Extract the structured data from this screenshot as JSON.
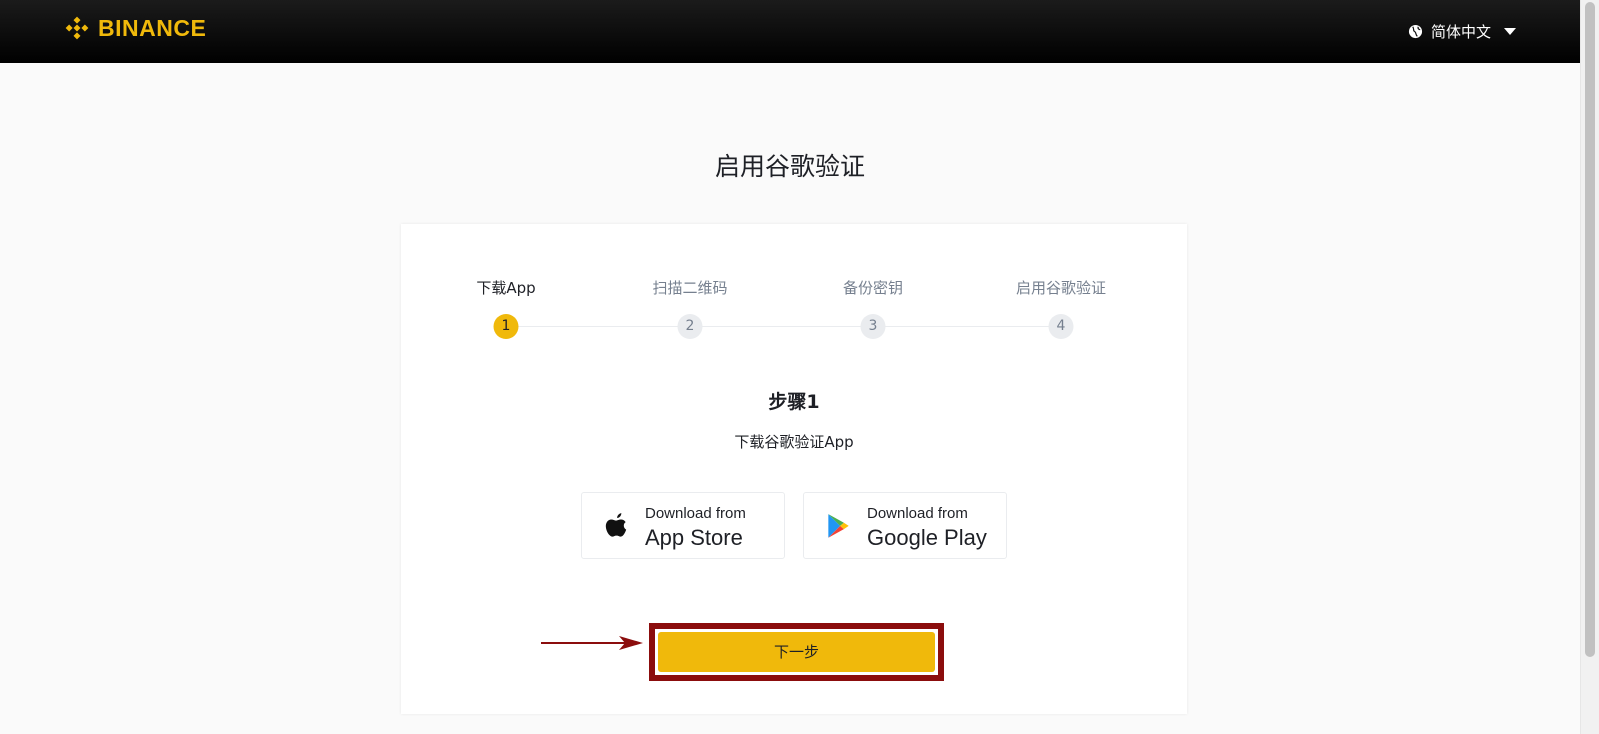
{
  "header": {
    "brand": "BINANCE",
    "language": "简体中文",
    "icons": {
      "logo": "binance-diamond-logo",
      "globe": "globe-icon",
      "caret": "chevron-down-icon"
    }
  },
  "page": {
    "title": "启用谷歌验证"
  },
  "steps": [
    {
      "label": "下载App",
      "number": "1",
      "active": true
    },
    {
      "label": "扫描二维码",
      "number": "2",
      "active": false
    },
    {
      "label": "备份密钥",
      "number": "3",
      "active": false
    },
    {
      "label": "启用谷歌验证",
      "number": "4",
      "active": false
    }
  ],
  "content": {
    "step_title": "步骤1",
    "step_desc": "下载谷歌验证App",
    "app_store": {
      "small": "Download from",
      "big": "App Store",
      "icon": "apple-icon"
    },
    "google_play": {
      "small": "Download from",
      "big": "Google Play",
      "icon": "google-play-icon"
    },
    "next_label": "下一步"
  },
  "colors": {
    "brand_yellow": "#f0b90b",
    "annotation_red": "#8b0d0d",
    "header_bg": "#0c0c0c"
  }
}
